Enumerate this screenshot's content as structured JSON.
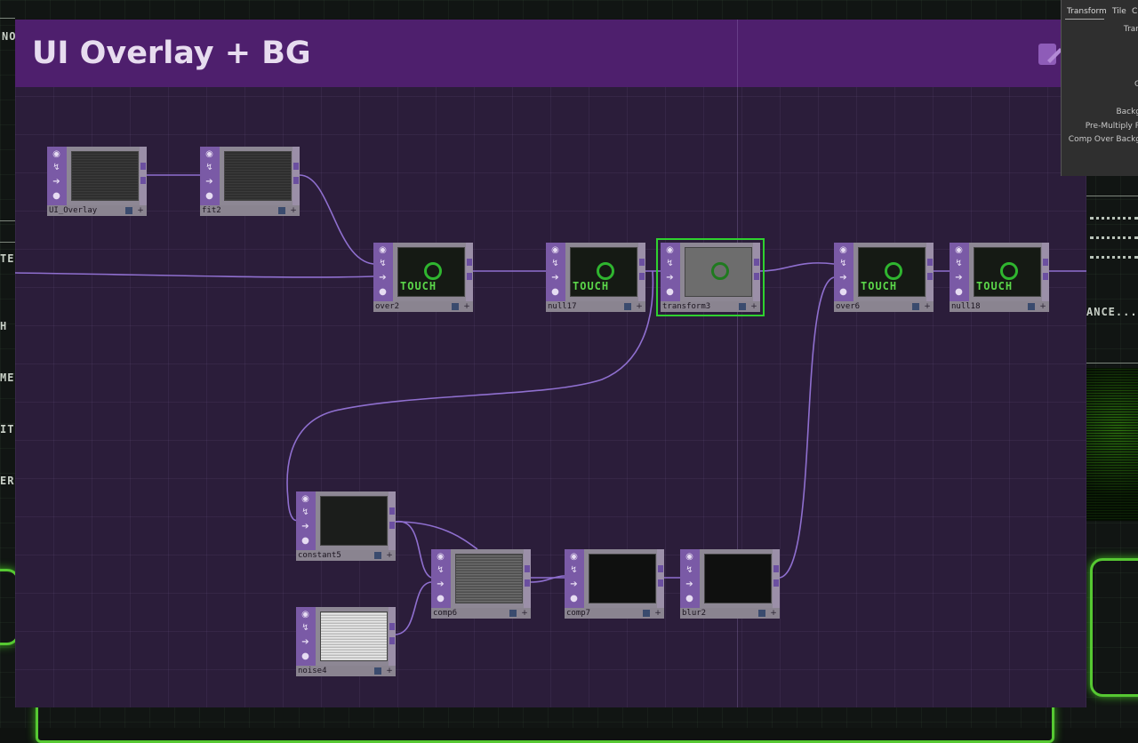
{
  "network": {
    "title": "UI Overlay + BG",
    "edit_icon": "edit-icon",
    "colors": {
      "title_bar": "#4e1f6d",
      "canvas": "#2b1d3a",
      "selected": "#2fd12f",
      "wire": "#8f6fcf"
    }
  },
  "nodes": [
    {
      "id": "ui_overlay",
      "name": "UI_Overlay",
      "thumb": "ui"
    },
    {
      "id": "fit2",
      "name": "fit2",
      "thumb": "ui"
    },
    {
      "id": "over2",
      "name": "over2",
      "thumb": "touch"
    },
    {
      "id": "null17",
      "name": "null17",
      "thumb": "touch"
    },
    {
      "id": "transform3",
      "name": "transform3",
      "thumb": "gray",
      "selected": true
    },
    {
      "id": "over6",
      "name": "over6",
      "thumb": "touch"
    },
    {
      "id": "null18",
      "name": "null18",
      "thumb": "touch"
    },
    {
      "id": "constant5",
      "name": "constant5",
      "thumb": "dark"
    },
    {
      "id": "comp6",
      "name": "comp6",
      "thumb": "static"
    },
    {
      "id": "comp7",
      "name": "comp7",
      "thumb": "dark2"
    },
    {
      "id": "blur2",
      "name": "blur2",
      "thumb": "dark2"
    },
    {
      "id": "noise4",
      "name": "noise4",
      "thumb": "noise"
    }
  ],
  "node_icons": [
    "viewer-icon",
    "bypass-icon",
    "arrow-icon",
    "lock-icon"
  ],
  "thumb_text": "TOUCH",
  "param_panel": {
    "tabs": [
      "Transform",
      "Tile",
      "C"
    ],
    "labels": [
      "Tran",
      "G",
      "Backg",
      "Pre-Multiply R",
      "Comp Over Backg"
    ]
  },
  "background_labels": [
    "NO",
    "TE",
    "H",
    "ME",
    "IT",
    "ER",
    "ANCE..."
  ]
}
